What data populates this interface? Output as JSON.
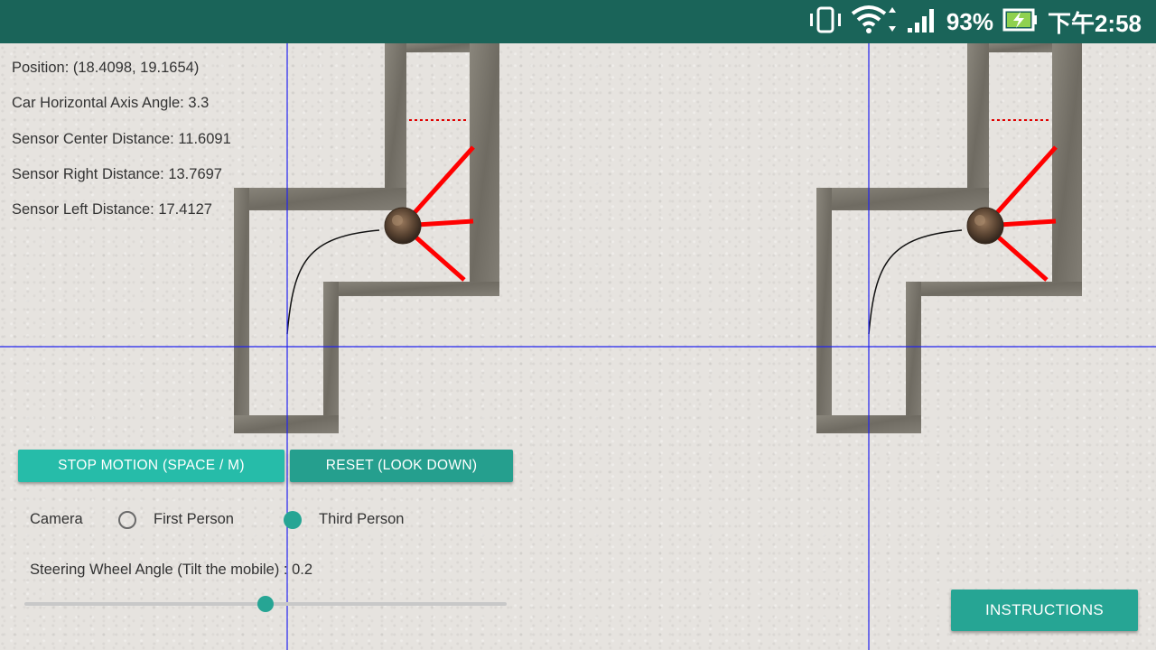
{
  "status_bar": {
    "battery_percent": "93%",
    "time": "下午2:58",
    "icons": [
      "vibrate-icon",
      "wifi-icon",
      "cellular-signal-icon",
      "battery-charging-icon"
    ]
  },
  "info": {
    "position": "Position: (18.4098, 19.1654)",
    "car_angle": "Car Horizontal Axis Angle: 3.3",
    "sensor_center": "Sensor Center Distance: 11.6091",
    "sensor_right": "Sensor Right Distance: 13.7697",
    "sensor_left": "Sensor Left Distance: 17.4127"
  },
  "buttons": {
    "stop_motion": "STOP MOTION (SPACE / M)",
    "reset": "RESET (LOOK DOWN)",
    "instructions": "INSTRUCTIONS"
  },
  "camera": {
    "label": "Camera",
    "options": [
      {
        "label": "First Person",
        "selected": false
      },
      {
        "label": "Third Person",
        "selected": true
      }
    ]
  },
  "steering": {
    "label": "Steering Wheel Angle (Tilt the mobile) : 0.2",
    "slider_fraction": 0.5
  },
  "colors": {
    "status_bar": "#1a6459",
    "accent": "#26a594",
    "sensor_ray": "#ff0000",
    "axis_line": "#1a1aff",
    "wall": "#7a766d"
  }
}
